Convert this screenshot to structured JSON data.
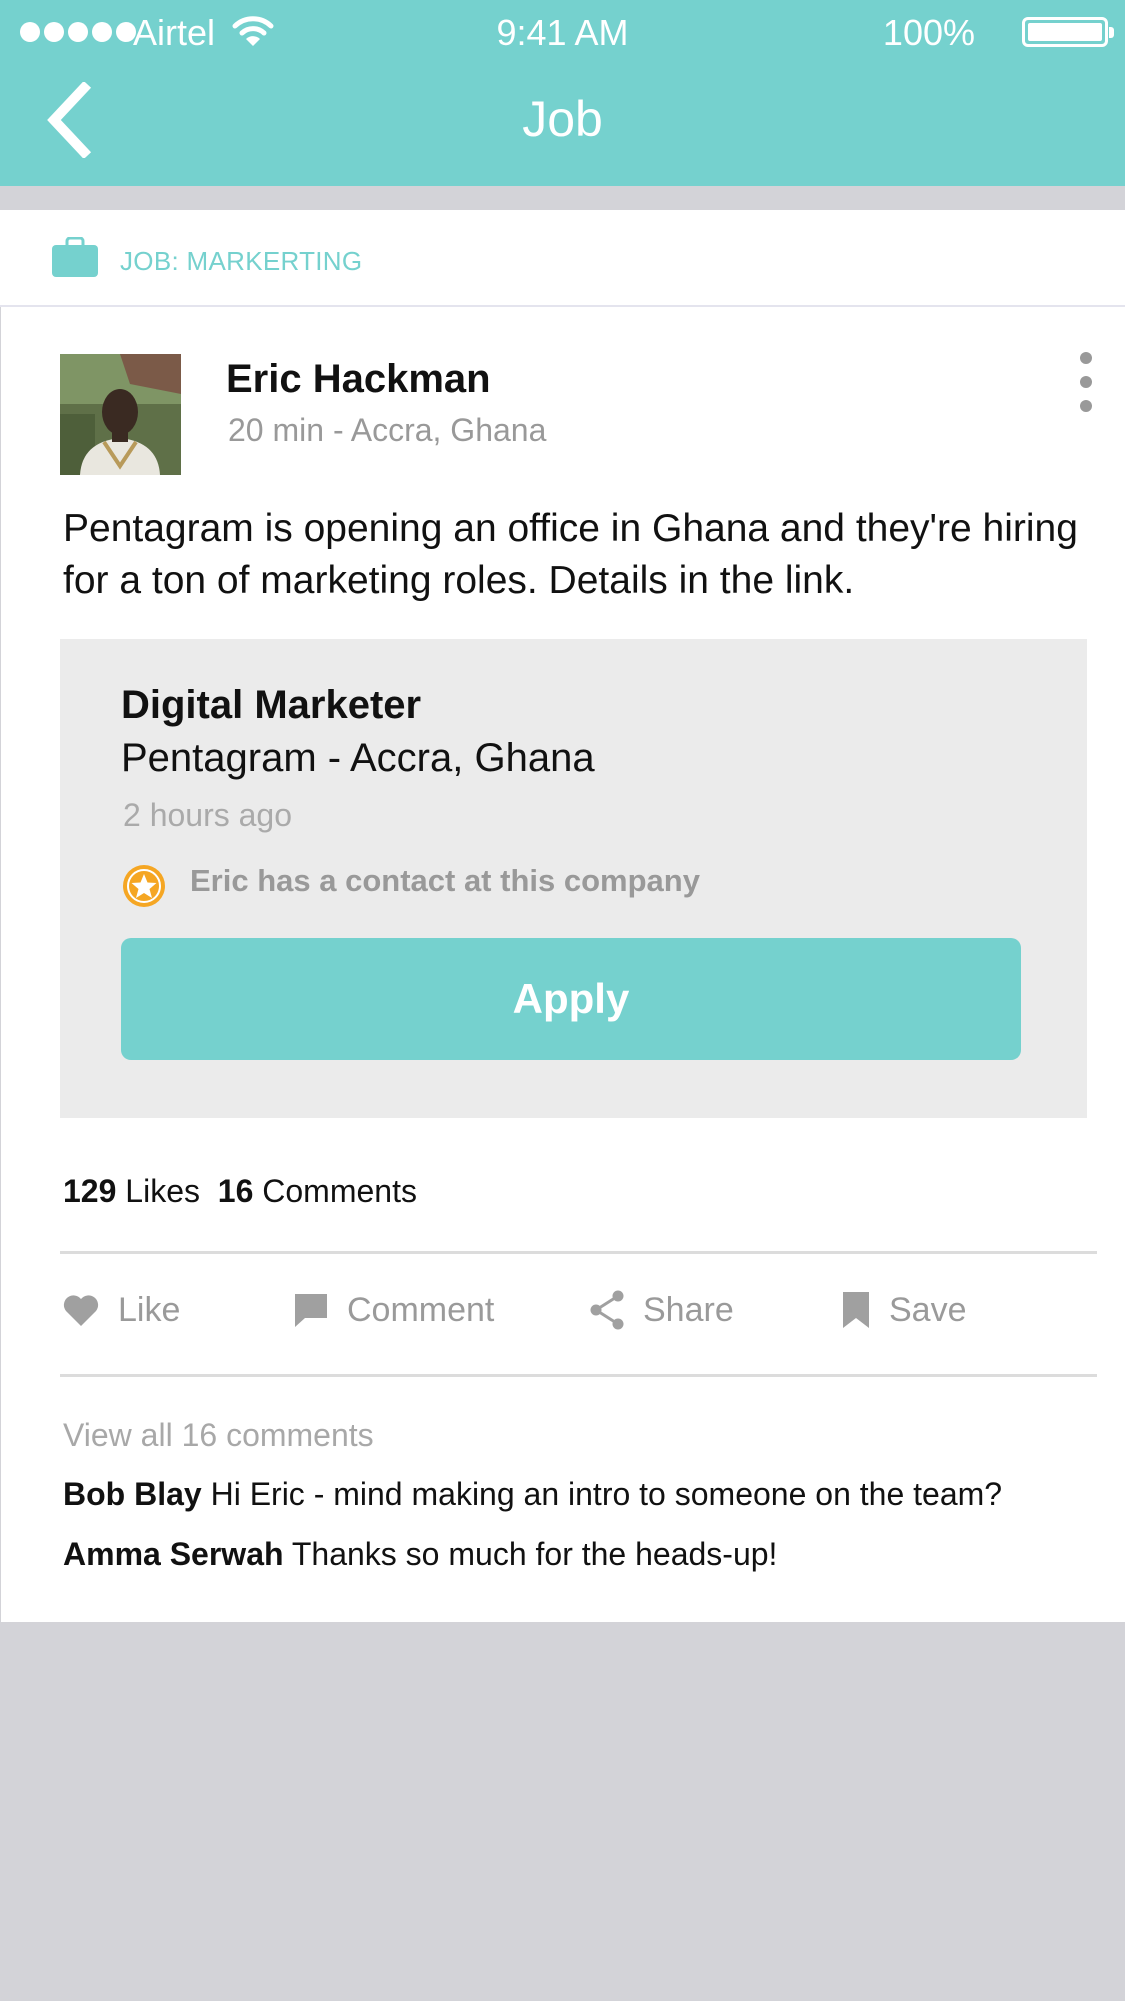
{
  "status_bar": {
    "carrier": "Airtel",
    "time": "9:41 AM",
    "battery": "100%"
  },
  "nav": {
    "title": "Job"
  },
  "category": {
    "label": "JOB: MARKERTING"
  },
  "post": {
    "author": "Eric Hackman",
    "meta": "20 min - Accra, Ghana",
    "text": "Pentagram is opening an office in Ghana and they're hiring for a ton of marketing roles. Details in the link."
  },
  "job": {
    "title": "Digital Marketer",
    "company": "Pentagram - Accra, Ghana",
    "posted": "2 hours ago",
    "contact_note": "Eric has a contact at this company",
    "apply_label": "Apply"
  },
  "counts": {
    "likes_count": "129",
    "likes_label": "Likes",
    "comments_count": "16",
    "comments_label": "Comments"
  },
  "actions": {
    "like": "Like",
    "comment": "Comment",
    "share": "Share",
    "save": "Save"
  },
  "comments": {
    "view_all": "View all 16 comments",
    "items": [
      {
        "author": "Bob Blay",
        "text": "Hi Eric - mind making an intro to someone on the team?"
      },
      {
        "author": "Amma Serwah",
        "text": "Thanks so much for the heads-up!"
      }
    ]
  },
  "colors": {
    "accent": "#75d1ce",
    "background": "#d3d3d8",
    "star_badge": "#f5a623",
    "muted_text": "#999999"
  },
  "icons": {
    "back": "chevron-left-icon",
    "category": "briefcase-icon",
    "more": "more-vertical-icon",
    "contact": "star-badge-icon",
    "like": "heart-icon",
    "comment": "speech-bubble-icon",
    "share": "share-icon",
    "save": "bookmark-icon"
  }
}
